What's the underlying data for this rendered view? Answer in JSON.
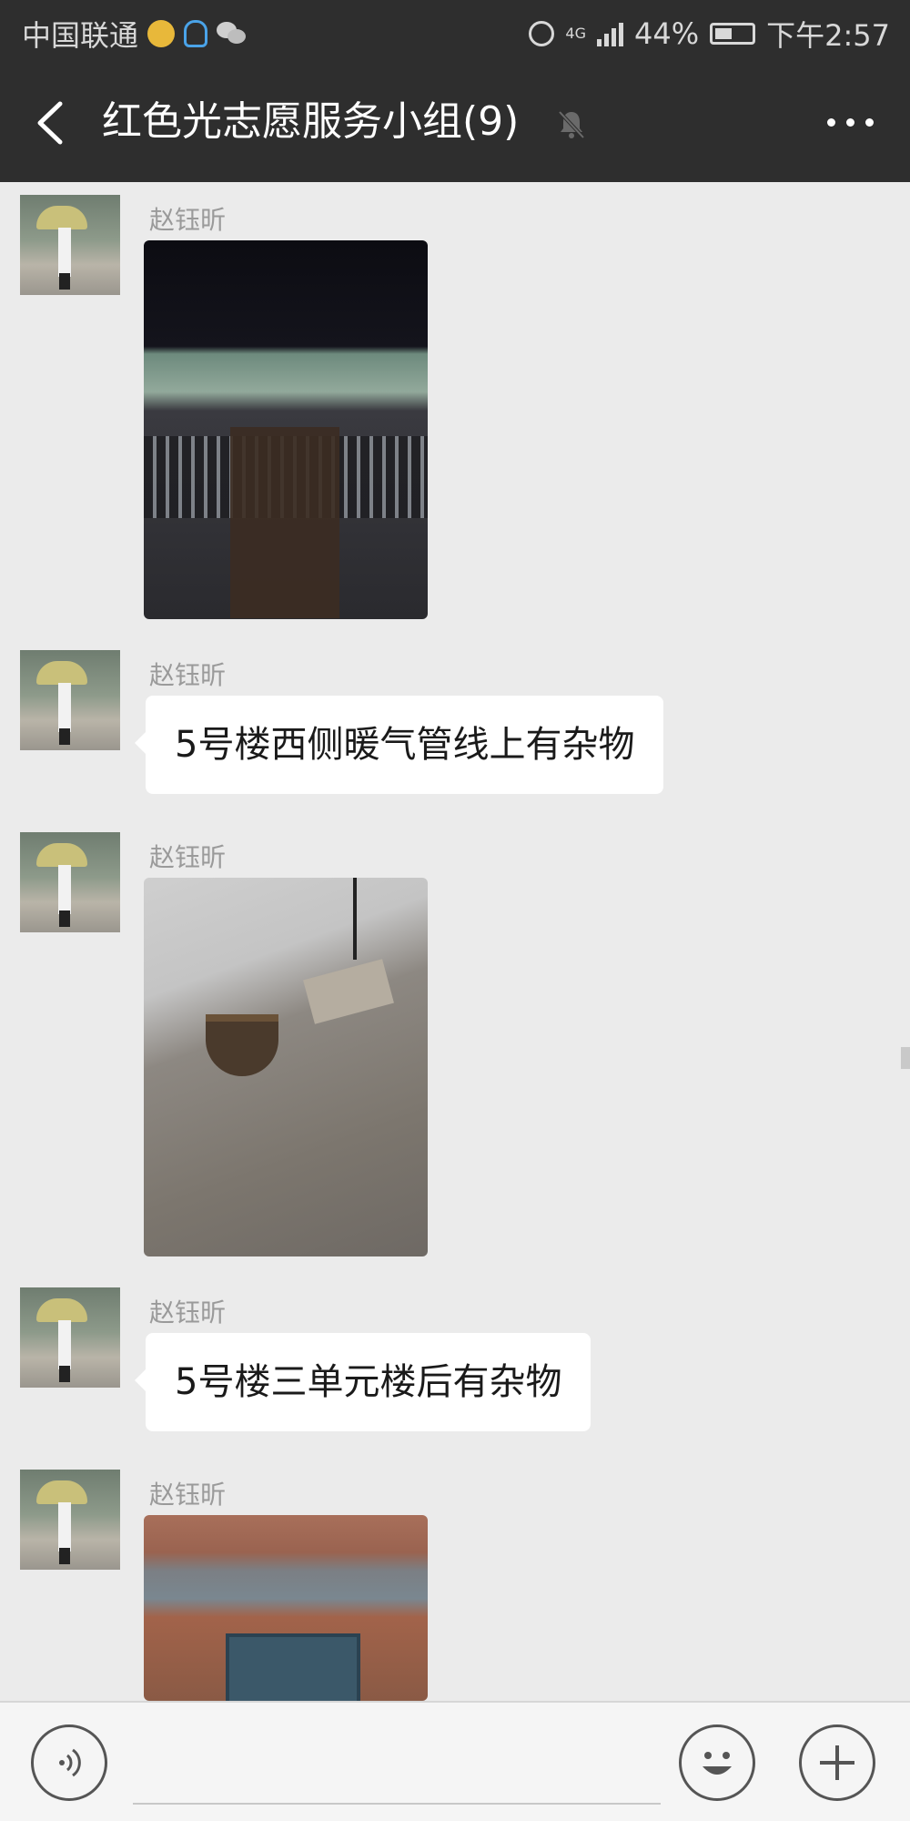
{
  "status_bar": {
    "carrier": "中国联通",
    "network": "4G",
    "battery": "44%",
    "time": "下午2:57"
  },
  "header": {
    "title": "红色光志愿服务小组(9)"
  },
  "messages": [
    {
      "sender": "赵钰昕",
      "type": "image"
    },
    {
      "sender": "赵钰昕",
      "type": "text",
      "text": "5号楼西侧暖气管线上有杂物"
    },
    {
      "sender": "赵钰昕",
      "type": "image"
    },
    {
      "sender": "赵钰昕",
      "type": "text",
      "text": "5号楼三单元楼后有杂物"
    },
    {
      "sender": "赵钰昕",
      "type": "image"
    }
  ],
  "input": {
    "value": ""
  },
  "icons": {
    "back": "chevron-left-icon",
    "mute": "bell-muted-icon",
    "more": "more-dots-icon",
    "voice": "voice-icon",
    "emoji": "emoji-icon",
    "plus": "plus-icon"
  }
}
